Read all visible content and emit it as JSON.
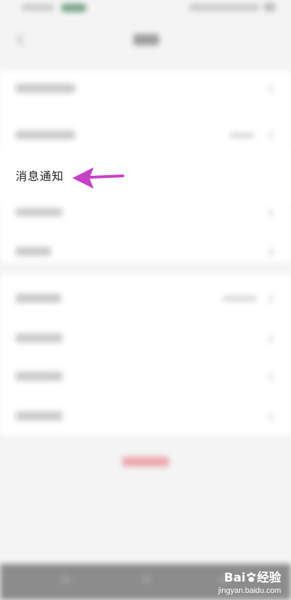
{
  "highlighted_item": {
    "label": "消息通知"
  },
  "watermark": {
    "logo_text": "Bai",
    "logo_suffix": "经验",
    "url": "jingyan.baidu.com"
  },
  "colors": {
    "arrow": "#c640c6",
    "logout_blurred": "#eea7ad",
    "status_pill": "#7aa58a"
  }
}
